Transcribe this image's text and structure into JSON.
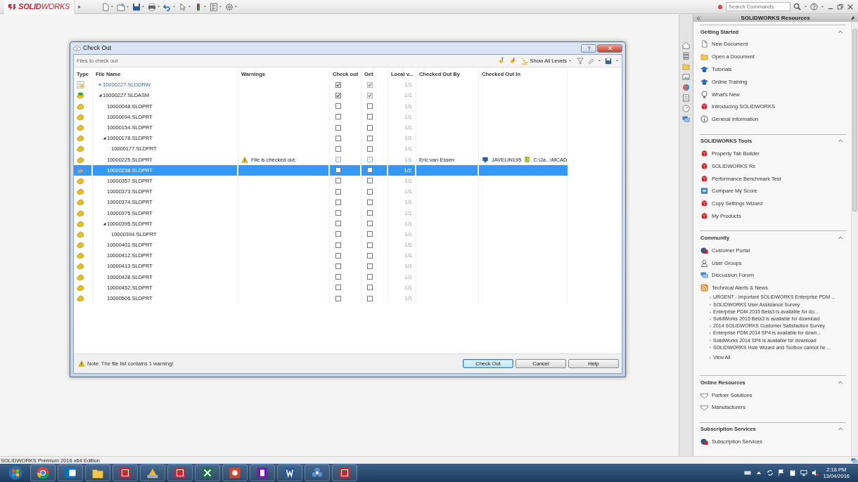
{
  "app": {
    "logo": "**SOLID**WORKS",
    "search": {
      "placeholder": "Search Commands"
    }
  },
  "dialog": {
    "title": "Check Out",
    "toolbar_label": "Files to check out",
    "levels_button": "Show All Levels",
    "columns": [
      "Type",
      "File Name",
      "Warnings",
      "Check out",
      "Get",
      "Local v...",
      "Checked Out By",
      "Checked Out In"
    ],
    "rows": [
      {
        "name": "10000227.SLDDRW",
        "kind": "drawing",
        "selected": false,
        "expanded": false,
        "check_out": {
          "checked": true,
          "disabled": false
        },
        "get": {
          "checked": true,
          "disabled": true
        },
        "version": "1/1"
      },
      {
        "name": "10000227.SLDASM",
        "kind": "assembly",
        "selected": false,
        "expanded": true,
        "check_out": {
          "checked": true,
          "disabled": false
        },
        "get": {
          "checked": true,
          "disabled": true
        },
        "version": "1/1",
        "children": [
          {
            "name": "10000048.SLDPRT",
            "kind": "part",
            "selected": false,
            "expanded": false,
            "check_out": {
              "checked": false,
              "disabled": false
            },
            "get": {
              "checked": false,
              "disabled": false
            },
            "version": "1/1"
          },
          {
            "name": "10000094.SLDPRT",
            "kind": "part",
            "selected": false,
            "expanded": false,
            "check_out": {
              "checked": false,
              "disabled": false
            },
            "get": {
              "checked": false,
              "disabled": false
            },
            "version": "1/1"
          },
          {
            "name": "10000154.SLDPRT",
            "kind": "part",
            "selected": false,
            "expanded": false,
            "check_out": {
              "checked": false,
              "disabled": false
            },
            "get": {
              "checked": false,
              "disabled": false
            },
            "version": "1/1"
          },
          {
            "name": "10000178.SLDPRT",
            "kind": "part",
            "selected": false,
            "expanded": true,
            "check_out": {
              "checked": false,
              "disabled": false
            },
            "get": {
              "checked": false,
              "disabled": false
            },
            "version": "1/1",
            "children": [
              {
                "name": "10000177.SLDPRT",
                "kind": "part",
                "selected": false,
                "expanded": false,
                "check_out": {
                  "checked": false,
                  "disabled": false
                },
                "get": {
                  "checked": false,
                  "disabled": false
                },
                "version": "1/1"
              }
            ]
          },
          {
            "name": "10000225.SLDPRT",
            "kind": "part",
            "selected": false,
            "expanded": false,
            "check_out": {
              "checked": false,
              "disabled": true
            },
            "get": {
              "checked": false,
              "disabled": true
            },
            "version": "1/1",
            "warning": "File is checked out.",
            "checked_out_by": "Eric van Essen",
            "checked_out_in": {
              "computer": "JAVELIN195",
              "path": "C:\\Ja...\\MCAD"
            }
          },
          {
            "name": "10000238.SLDPRT",
            "kind": "part",
            "selected": true,
            "expanded": false,
            "check_out": {
              "checked": false,
              "disabled": false
            },
            "get": {
              "checked": false,
              "disabled": false
            },
            "version": "1/2"
          },
          {
            "name": "10000357.SLDPRT",
            "kind": "part",
            "selected": false,
            "expanded": false,
            "check_out": {
              "checked": false,
              "disabled": false
            },
            "get": {
              "checked": false,
              "disabled": false
            },
            "version": "1/1"
          },
          {
            "name": "10000373.SLDPRT",
            "kind": "part",
            "selected": false,
            "expanded": false,
            "check_out": {
              "checked": false,
              "disabled": false
            },
            "get": {
              "checked": false,
              "disabled": false
            },
            "version": "1/1"
          },
          {
            "name": "10000374.SLDPRT",
            "kind": "part",
            "selected": false,
            "expanded": false,
            "check_out": {
              "checked": false,
              "disabled": false
            },
            "get": {
              "checked": false,
              "disabled": false
            },
            "version": "1/1"
          },
          {
            "name": "10000375.SLDPRT",
            "kind": "part",
            "selected": false,
            "expanded": false,
            "check_out": {
              "checked": false,
              "disabled": false
            },
            "get": {
              "checked": false,
              "disabled": false
            },
            "version": "1/1"
          },
          {
            "name": "10000395.SLDPRT",
            "kind": "part",
            "selected": false,
            "expanded": true,
            "check_out": {
              "checked": false,
              "disabled": false
            },
            "get": {
              "checked": false,
              "disabled": false
            },
            "version": "1/1",
            "children": [
              {
                "name": "10000394.SLDPRT",
                "kind": "part",
                "selected": false,
                "expanded": false,
                "check_out": {
                  "checked": false,
                  "disabled": false
                },
                "get": {
                  "checked": false,
                  "disabled": false
                },
                "version": "1/1"
              }
            ]
          },
          {
            "name": "10000401.SLDPRT",
            "kind": "part",
            "selected": false,
            "expanded": false,
            "check_out": {
              "checked": false,
              "disabled": false
            },
            "get": {
              "checked": false,
              "disabled": false
            },
            "version": "1/1"
          },
          {
            "name": "10000412.SLDPRT",
            "kind": "part",
            "selected": false,
            "expanded": false,
            "check_out": {
              "checked": false,
              "disabled": false
            },
            "get": {
              "checked": false,
              "disabled": false
            },
            "version": "1/1"
          },
          {
            "name": "10000413.SLDPRT",
            "kind": "part",
            "selected": false,
            "expanded": false,
            "check_out": {
              "checked": false,
              "disabled": false
            },
            "get": {
              "checked": false,
              "disabled": false
            },
            "version": "1/1"
          },
          {
            "name": "10000428.SLDPRT",
            "kind": "part",
            "selected": false,
            "expanded": false,
            "check_out": {
              "checked": false,
              "disabled": false
            },
            "get": {
              "checked": false,
              "disabled": false
            },
            "version": "1/1"
          },
          {
            "name": "10000452.SLDPRT",
            "kind": "part",
            "selected": false,
            "expanded": false,
            "check_out": {
              "checked": false,
              "disabled": false
            },
            "get": {
              "checked": false,
              "disabled": false
            },
            "version": "1/1"
          },
          {
            "name": "10000506.SLDPRT",
            "kind": "part",
            "selected": false,
            "expanded": false,
            "check_out": {
              "checked": false,
              "disabled": false
            },
            "get": {
              "checked": false,
              "disabled": false
            },
            "version": "1/1"
          }
        ]
      }
    ],
    "note": "Note: The file list contains 1 warning!",
    "buttons": [
      {
        "label": "Check Out",
        "default": true
      },
      {
        "label": "Cancel",
        "default": false
      },
      {
        "label": "Help",
        "default": false
      }
    ]
  },
  "task_pane": {
    "title": "SOLIDWORKS Resources",
    "sections": [
      {
        "title": "Getting Started",
        "expanded": true,
        "items": [
          "New Document",
          "Open a Document",
          "Tutorials",
          "Online Training",
          "What's New",
          "Introducing SOLIDWORKS",
          "General Information"
        ]
      },
      {
        "title": "SOLIDWORKS Tools",
        "expanded": true,
        "items": [
          "Property Tab Builder",
          "SOLIDWORKS Rx",
          "Performance Benchmark Test",
          "Compare My Score",
          "Copy Settings Wizard",
          "My Products"
        ]
      },
      {
        "title": "Community",
        "expanded": true,
        "items": [
          "Customer Portal",
          "User Groups",
          "Discussion Forum",
          "Technical Alerts & News"
        ],
        "news": [
          "URGENT - Important SOLIDWORKS Enterprise PDM ...",
          "SOLIDWORKS User Assistance Survey",
          "Enterprise PDM 2015 Beta3 is available for do...",
          "SolidWorks 2015 Beta3 is available for download",
          "2014 SOLIDWORKS Customer Satisfaction Survey",
          "Enterprise PDM 2014 SP4 is available for down...",
          "SolidWorks 2014 SP4 is available for download",
          "SOLIDWORKS Hole Wizard and Toolbox cannot be ..."
        ],
        "view_all": "View All"
      },
      {
        "title": "Online Resources",
        "expanded": true,
        "items": [
          "Partner Solutions",
          "Manufacturers"
        ]
      },
      {
        "title": "Subscription Services",
        "expanded": true,
        "items": [
          "Subscription Services"
        ]
      }
    ]
  },
  "status_bar": "SOLIDWORKS Premium 2016 x64 Edition",
  "clock": {
    "time": "2:18 PM",
    "date": "13/04/2016"
  }
}
